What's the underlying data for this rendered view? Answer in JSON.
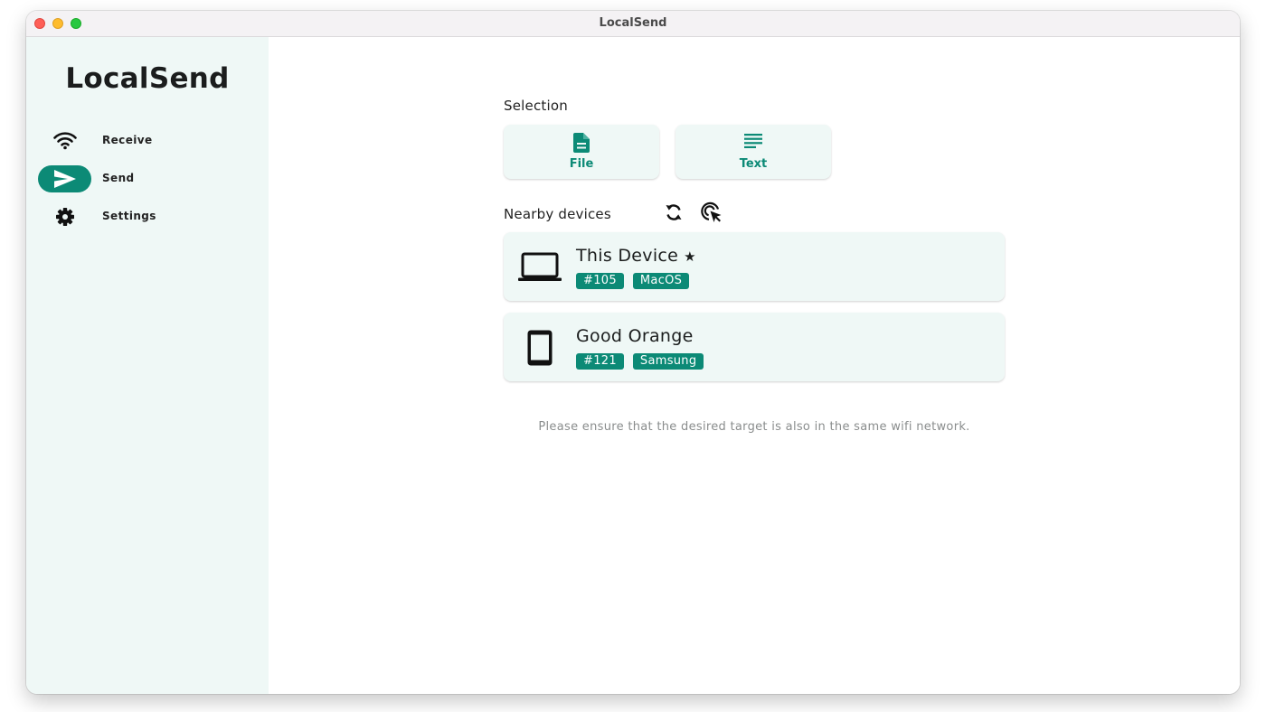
{
  "window": {
    "title": "LocalSend"
  },
  "sidebar": {
    "app_title": "LocalSend",
    "items": [
      {
        "label": "Receive",
        "icon": "wifi-icon",
        "active": false
      },
      {
        "label": "Send",
        "icon": "send-icon",
        "active": true
      },
      {
        "label": "Settings",
        "icon": "gear-icon",
        "active": false
      }
    ]
  },
  "main": {
    "selection_label": "Selection",
    "selection_buttons": [
      {
        "label": "File",
        "icon": "file-icon"
      },
      {
        "label": "Text",
        "icon": "text-lines-icon"
      }
    ],
    "nearby_label": "Nearby devices",
    "nearby_actions": [
      {
        "icon": "refresh-icon"
      },
      {
        "icon": "scan-target-icon"
      }
    ],
    "devices": [
      {
        "name": "This Device",
        "starred": true,
        "id": "#105",
        "os": "MacOS",
        "icon": "laptop-icon"
      },
      {
        "name": "Good Orange",
        "starred": false,
        "id": "#121",
        "os": "Samsung",
        "icon": "tablet-icon"
      }
    ],
    "hint": "Please ensure that the desired target is also in the same wifi network."
  },
  "colors": {
    "accent": "#0c8a76",
    "sidebar_bg": "#eff8f6",
    "card_bg": "#eff8f6"
  }
}
